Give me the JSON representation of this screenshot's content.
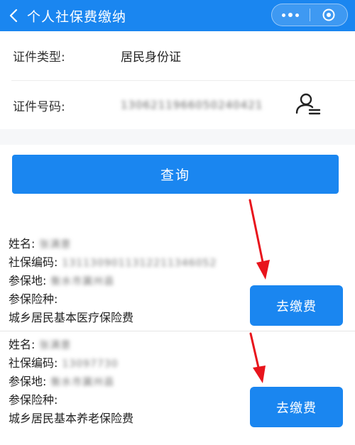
{
  "header": {
    "title": "个人社保费缴纳"
  },
  "form": {
    "id_type_label": "证件类型:",
    "id_type_value": "居民身份证",
    "id_number_label": "证件号码:",
    "id_number_value": "1306211966050240421"
  },
  "query_button": "查询",
  "records": [
    {
      "name_label": "姓名:",
      "name_value": "张满意",
      "code_label": "社保编码:",
      "code_value": "1311309011312211346052",
      "place_label": "参保地:",
      "place_value": "衡水市冀州县",
      "type_label": "参保险种:",
      "type_value": "城乡居民基本医疗保险费",
      "pay_button": "去缴费"
    },
    {
      "name_label": "姓名:",
      "name_value": "张满意",
      "code_label": "社保编码:",
      "code_value": "13097730",
      "place_label": "参保地:",
      "place_value": "衡水市冀州县",
      "type_label": "参保险种:",
      "type_value": "城乡居民基本养老保险费",
      "pay_button": "去缴费"
    }
  ],
  "colors": {
    "primary": "#1a86f0",
    "arrow": "#e8141c",
    "band": "#f6f7f9"
  },
  "icons": [
    "back-chevron-icon",
    "more-dots-icon",
    "close-target-icon",
    "id-card-scan-icon",
    "red-arrow-icon"
  ]
}
